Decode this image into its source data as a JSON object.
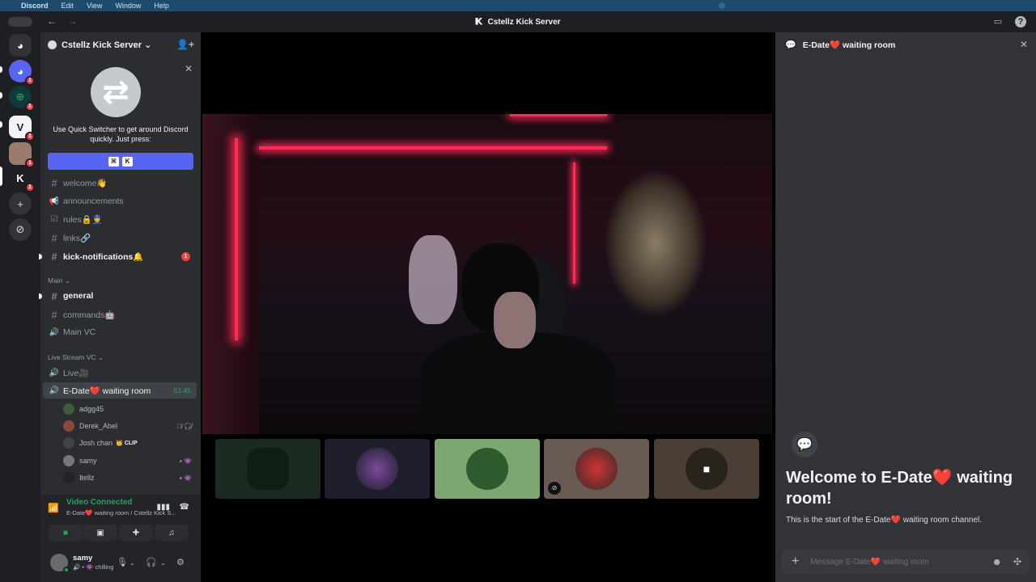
{
  "menubar": {
    "apple": "",
    "app": "Discord",
    "items": [
      "Edit",
      "View",
      "Window",
      "Help"
    ]
  },
  "window": {
    "title": "Cstellz Kick Server",
    "back": "←",
    "forward": "→"
  },
  "server": {
    "name": "Cstellz Kick Server ⌄"
  },
  "quick_switcher": {
    "text": "Use Quick Switcher to get around Discord quickly. Just press:",
    "key1": "⌘",
    "key2": "K",
    "close": "✕"
  },
  "channels": [
    {
      "name": "welcome👋",
      "icon": "#"
    },
    {
      "name": "announcements",
      "icon": "📢"
    },
    {
      "name": "rules🔒👮",
      "icon": "☑"
    },
    {
      "name": "links🔗",
      "icon": "#"
    },
    {
      "name": "kick-notifications🔔",
      "icon": "#",
      "badge": "1"
    }
  ],
  "categories": {
    "main": "Main ⌄",
    "live": "Live Stream VC ⌄"
  },
  "main_channels": [
    {
      "name": "general",
      "icon": "#"
    },
    {
      "name": "commands🤖",
      "icon": "#"
    },
    {
      "name": "Main VC",
      "icon": "🔊"
    }
  ],
  "live_channels": [
    {
      "name": "Live🎥",
      "icon": "🔊"
    },
    {
      "name": "E-Date❤️ waiting room",
      "icon": "🔊",
      "time": "51:45"
    }
  ],
  "voice_users": [
    {
      "name": "adgg45",
      "color": "#3b5b3a"
    },
    {
      "name": "Derek_Abel",
      "color": "#8a4a3a"
    },
    {
      "name": "Josh chan",
      "tag": "👑 CLIP",
      "color": "#444"
    },
    {
      "name": "samy",
      "color": "#777"
    },
    {
      "name": "ʇtellz",
      "color": "#222"
    }
  ],
  "voice_connection": {
    "status": "Video Connected",
    "detail": "E-Date❤️ waiting room / Cstellz Kick S..."
  },
  "user": {
    "name": "samy",
    "status": "🔊 • 👾 chilling"
  },
  "thread": {
    "title": "E-Date❤️ waiting room",
    "welcome": "Welcome to E-Date❤️ waiting room!",
    "subtitle": "This is the start of the E-Date❤️ waiting room channel.",
    "placeholder": "Message E-Date❤️ waiting room"
  },
  "colors": {
    "accent": "#5865f2",
    "online": "#23a55a",
    "danger": "#f23f43",
    "led": "#ff2a55"
  }
}
